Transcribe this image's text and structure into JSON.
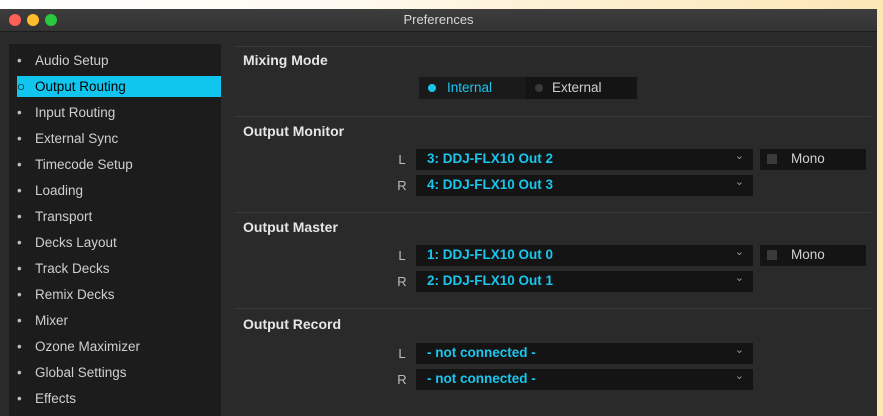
{
  "window": {
    "title": "Preferences"
  },
  "sidebar": {
    "items": [
      {
        "label": "Audio Setup",
        "bullet": "•",
        "selected": false
      },
      {
        "label": "Output Routing",
        "bullet": "○",
        "selected": true
      },
      {
        "label": "Input Routing",
        "bullet": "•",
        "selected": false
      },
      {
        "label": "External Sync",
        "bullet": "•",
        "selected": false
      },
      {
        "label": "Timecode Setup",
        "bullet": "•",
        "selected": false
      },
      {
        "label": "Loading",
        "bullet": "•",
        "selected": false
      },
      {
        "label": "Transport",
        "bullet": "•",
        "selected": false
      },
      {
        "label": "Decks Layout",
        "bullet": "•",
        "selected": false
      },
      {
        "label": "Track Decks",
        "bullet": "•",
        "selected": false
      },
      {
        "label": "Remix Decks",
        "bullet": "•",
        "selected": false
      },
      {
        "label": "Mixer",
        "bullet": "•",
        "selected": false
      },
      {
        "label": "Ozone Maximizer",
        "bullet": "•",
        "selected": false
      },
      {
        "label": "Global Settings",
        "bullet": "•",
        "selected": false
      },
      {
        "label": "Effects",
        "bullet": "•",
        "selected": false
      }
    ]
  },
  "mixing_mode": {
    "title": "Mixing Mode",
    "internal_label": "Internal",
    "external_label": "External",
    "selected": "Internal"
  },
  "output_monitor": {
    "title": "Output Monitor",
    "left_channel": "L",
    "right_channel": "R",
    "left_value": "3: DDJ-FLX10 Out 2",
    "right_value": "4: DDJ-FLX10 Out 3",
    "mono_label": "Mono",
    "mono_checked": false
  },
  "output_master": {
    "title": "Output Master",
    "left_channel": "L",
    "right_channel": "R",
    "left_value": "1: DDJ-FLX10 Out 0",
    "right_value": "2: DDJ-FLX10 Out 1",
    "mono_label": "Mono",
    "mono_checked": false
  },
  "output_record": {
    "title": "Output Record",
    "left_channel": "L",
    "right_channel": "R",
    "left_value": "- not connected -",
    "right_value": "- not connected -"
  },
  "icons": {
    "chevron": "⌄",
    "close": "close-icon",
    "minimize": "minimize-icon",
    "maximize": "maximize-icon"
  },
  "colors": {
    "accent": "#10c6ee",
    "panel_bg": "#2a2a2a",
    "sidebar_bg": "#1c1c1c",
    "control_bg": "#141414"
  }
}
